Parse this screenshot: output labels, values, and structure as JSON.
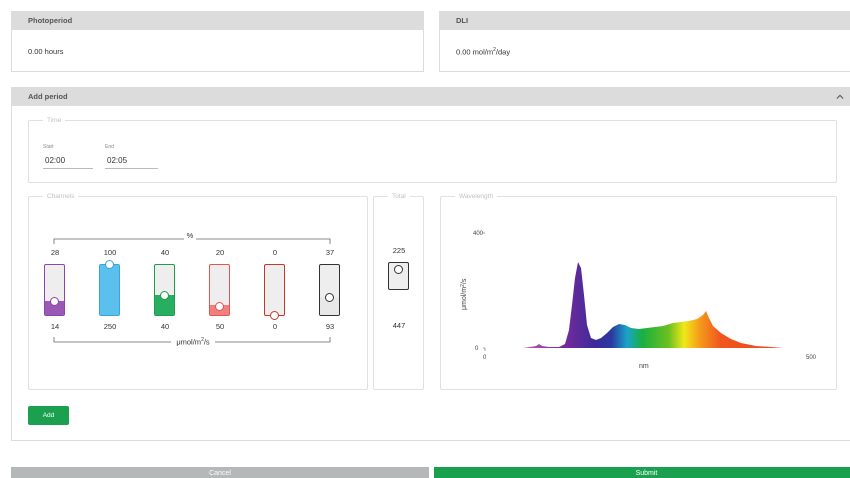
{
  "photoperiod": {
    "title": "Photoperiod",
    "value": "0.00 hours"
  },
  "dli": {
    "title": "DLI",
    "value_prefix": "0.00 mol/m",
    "value_sup": "2",
    "value_suffix": "/day"
  },
  "add_period": {
    "title": "Add period",
    "time": {
      "legend": "Time",
      "start_label": "Start",
      "start_value": "02:00",
      "end_label": "End",
      "end_value": "02:05"
    },
    "channels": {
      "legend": "Channels",
      "percent_label": "%",
      "unit_prefix": "μmol/m",
      "unit_sup": "2",
      "unit_suffix": "/s",
      "items": [
        {
          "percent": "28",
          "umol": "14",
          "level": 0.28,
          "color": "#9b59b6",
          "border": "#8e44ad"
        },
        {
          "percent": "100",
          "umol": "250",
          "level": 1.0,
          "color": "#5bc0eb",
          "border": "#3aa5d8"
        },
        {
          "percent": "40",
          "umol": "40",
          "level": 0.4,
          "color": "#27ae60",
          "border": "#1e9c50"
        },
        {
          "percent": "20",
          "umol": "50",
          "level": 0.2,
          "color": "#f08080",
          "border": "#e55353"
        },
        {
          "percent": "0",
          "umol": "0",
          "level": 0.0,
          "color": "#c0392b",
          "border": "#c0392b"
        },
        {
          "percent": "37",
          "umol": "93",
          "level": 0.37,
          "color": "#e8e8e8",
          "border": "#333333"
        }
      ]
    },
    "total": {
      "legend": "Total",
      "top": "225",
      "bottom": "447",
      "level": 0.74
    },
    "wavelength": {
      "legend": "Wavelength",
      "y_ticks": [
        "400",
        "0"
      ],
      "x_ticks": [
        "0",
        "500"
      ],
      "xlabel": "nm",
      "ylabel_prefix": "μmol/m",
      "ylabel_sup": "2",
      "ylabel_suffix": "/s"
    },
    "add_label": "Add"
  },
  "footer": {
    "cancel_label": "Cancel",
    "submit_label": "Submit"
  }
}
